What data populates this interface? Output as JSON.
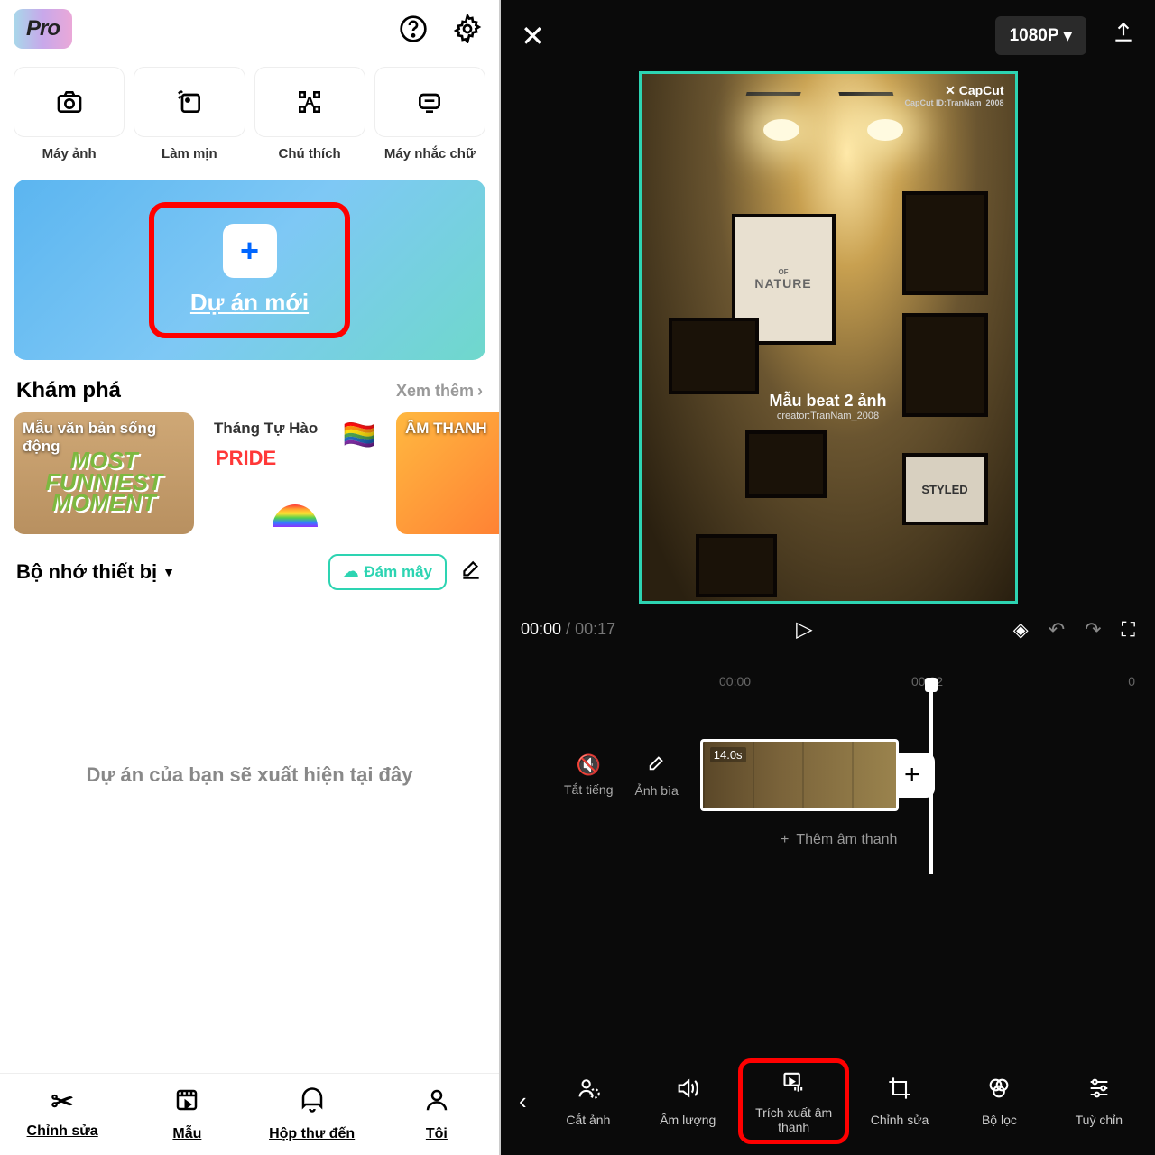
{
  "left": {
    "pro_badge": "Pro",
    "actions": [
      {
        "label": "Máy ảnh"
      },
      {
        "label": "Làm mịn"
      },
      {
        "label": "Chú thích"
      },
      {
        "label": "Máy nhắc chữ"
      }
    ],
    "new_project_label": "Dự án mới",
    "explore": {
      "title": "Khám phá",
      "see_more": "Xem thêm",
      "cards": [
        {
          "label": "Mẫu văn bản sống động",
          "banner": "MOST FUNNIEST MOMENT"
        },
        {
          "label": "Tháng Tự Hào",
          "banner": "PRIDE"
        },
        {
          "label": "ÂM THANH"
        }
      ]
    },
    "storage": {
      "title": "Bộ nhớ thiết bị",
      "cloud_label": "Đám mây"
    },
    "empty_state": "Dự án của bạn sẽ xuất hiện tại đây",
    "nav": [
      {
        "label": "Chỉnh sửa"
      },
      {
        "label": "Mẫu"
      },
      {
        "label": "Hộp thư đến"
      },
      {
        "label": "Tôi"
      }
    ]
  },
  "right": {
    "resolution": "1080P ▾",
    "watermark": {
      "brand": "✕ CapCut",
      "id": "CapCut ID:TranNam_2008"
    },
    "frame_nature": {
      "small": "OF",
      "big": "NATURE"
    },
    "frame_styled": "STYLED",
    "preview_text": {
      "title": "Mẫu beat 2 ảnh",
      "sub": "creator:TranNam_2008"
    },
    "time": {
      "current": "00:00",
      "sep": " / ",
      "total": "00:17"
    },
    "ticks": [
      "00:00",
      "00:02",
      "0"
    ],
    "timeline_btns": [
      {
        "label": "Tắt tiếng"
      },
      {
        "label": "Ảnh bìa"
      }
    ],
    "clip_label": "14.0s",
    "add_sound": "Thêm âm thanh",
    "edit_nav": [
      {
        "label": "Cắt ảnh"
      },
      {
        "label": "Âm lượng"
      },
      {
        "label": "Trích xuất âm thanh"
      },
      {
        "label": "Chỉnh sửa"
      },
      {
        "label": "Bộ lọc"
      },
      {
        "label": "Tuỳ chỉn"
      }
    ]
  }
}
